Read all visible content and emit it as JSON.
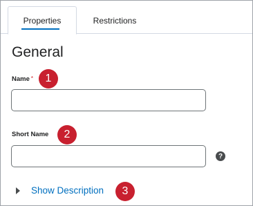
{
  "tabs": [
    {
      "label": "Properties",
      "active": true
    },
    {
      "label": "Restrictions",
      "active": false
    }
  ],
  "section": {
    "heading": "General"
  },
  "fields": {
    "name": {
      "label": "Name",
      "required_marker": "*",
      "value": ""
    },
    "short_name": {
      "label": "Short Name",
      "value": ""
    }
  },
  "help_icon": {
    "glyph": "?",
    "icon": "help-icon"
  },
  "show_description": {
    "label": "Show Description",
    "icon": "caret-right-icon"
  },
  "callouts": [
    "1",
    "2",
    "3"
  ],
  "colors": {
    "accent": "#006fbf",
    "callout": "#c8202f",
    "tab_border": "#d3d9e3",
    "input_border": "#6e7477"
  }
}
